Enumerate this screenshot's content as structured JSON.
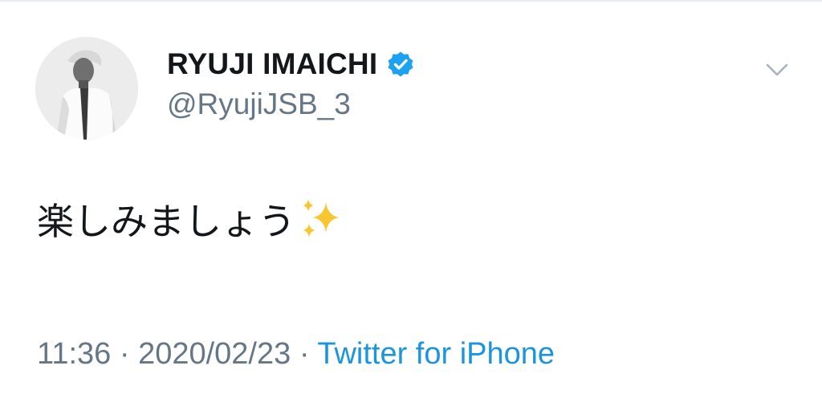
{
  "author": {
    "display_name": "RYUJI IMAICHI",
    "handle": "@RyujiJSB_3",
    "verified": true,
    "verified_badge_color": "#1da1f2"
  },
  "tweet": {
    "text": "楽しみましょう",
    "emoji": "sparkles-icon"
  },
  "meta": {
    "time": "11:36",
    "separator": "·",
    "date": "2020/02/23",
    "source": "Twitter for iPhone"
  },
  "colors": {
    "text_primary": "#14171a",
    "text_secondary": "#657786",
    "link": "#1b95e0"
  }
}
